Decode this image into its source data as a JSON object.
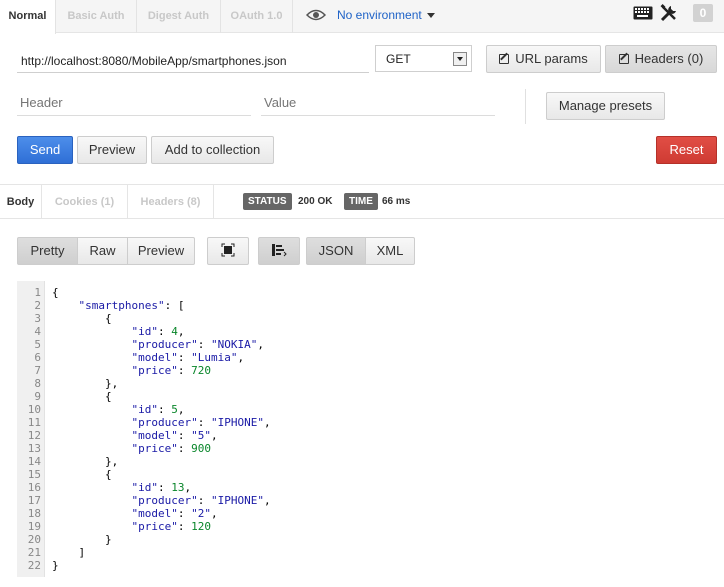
{
  "auth_tabs": [
    {
      "label": "Normal",
      "active": true
    },
    {
      "label": "Basic Auth",
      "active": false
    },
    {
      "label": "Digest Auth",
      "active": false
    },
    {
      "label": "OAuth 1.0",
      "active": false
    }
  ],
  "environment": {
    "label": "No environment",
    "icon": "eye-icon"
  },
  "toolbar": {
    "keyboard_icon": "keyboard-icon",
    "settings_icon": "wrench-screwdriver-icon",
    "badge_count": "0"
  },
  "request": {
    "url": "http://localhost:8080/MobileApp/smartphones.json",
    "method": "GET",
    "url_params_label": "URL params",
    "headers_label": "Headers (0)",
    "header_placeholder": "Header",
    "value_placeholder": "Value",
    "manage_presets_label": "Manage presets",
    "send_label": "Send",
    "preview_label": "Preview",
    "add_collection_label": "Add to collection",
    "reset_label": "Reset"
  },
  "response_tabs": [
    {
      "label": "Body",
      "active": true
    },
    {
      "label": "Cookies (1)",
      "active": false
    },
    {
      "label": "Headers (8)",
      "active": false
    }
  ],
  "status": {
    "status_label": "STATUS",
    "status_value": "200 OK",
    "time_label": "TIME",
    "time_value": "66 ms"
  },
  "view_buttons": {
    "pretty": "Pretty",
    "raw": "Raw",
    "preview": "Preview",
    "json": "JSON",
    "xml": "XML"
  },
  "code_lines": [
    {
      "n": "1",
      "t": "{"
    },
    {
      "n": "2",
      "t": "    \"smartphones\": ["
    },
    {
      "n": "3",
      "t": "        {"
    },
    {
      "n": "4",
      "t": "            \"id\": 4,"
    },
    {
      "n": "5",
      "t": "            \"producer\": \"NOKIA\","
    },
    {
      "n": "6",
      "t": "            \"model\": \"Lumia\","
    },
    {
      "n": "7",
      "t": "            \"price\": 720"
    },
    {
      "n": "8",
      "t": "        },"
    },
    {
      "n": "9",
      "t": "        {"
    },
    {
      "n": "10",
      "t": "            \"id\": 5,"
    },
    {
      "n": "11",
      "t": "            \"producer\": \"IPHONE\","
    },
    {
      "n": "12",
      "t": "            \"model\": \"5\","
    },
    {
      "n": "13",
      "t": "            \"price\": 900"
    },
    {
      "n": "14",
      "t": "        },"
    },
    {
      "n": "15",
      "t": "        {"
    },
    {
      "n": "16",
      "t": "            \"id\": 13,"
    },
    {
      "n": "17",
      "t": "            \"producer\": \"IPHONE\","
    },
    {
      "n": "18",
      "t": "            \"model\": \"2\","
    },
    {
      "n": "19",
      "t": "            \"price\": 120"
    },
    {
      "n": "20",
      "t": "        }"
    },
    {
      "n": "21",
      "t": "    ]"
    },
    {
      "n": "22",
      "t": "}"
    }
  ]
}
